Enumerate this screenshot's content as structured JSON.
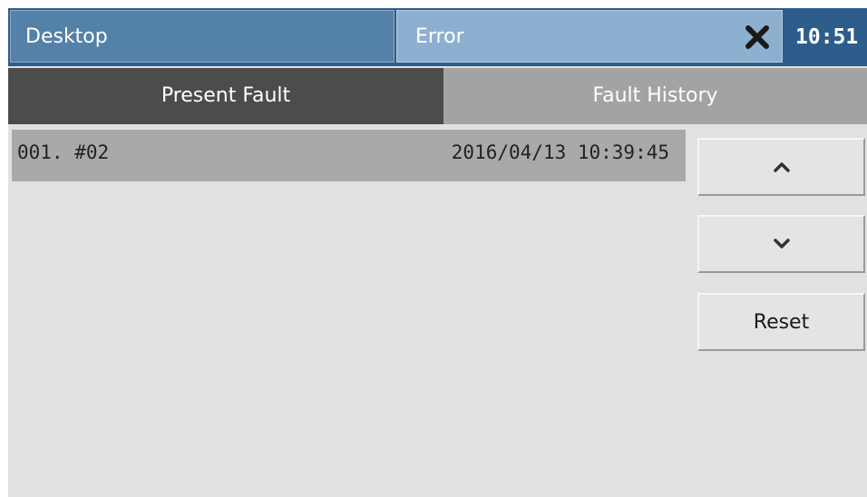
{
  "titlebar": {
    "desktop_label": "Desktop",
    "error_label": "Error",
    "close_icon": "close-x-icon",
    "clock": "10:51"
  },
  "tabs": [
    {
      "label": "Present Fault",
      "active": true
    },
    {
      "label": "Fault History",
      "active": false
    }
  ],
  "faults": [
    {
      "code": "001. #02",
      "timestamp": "2016/04/13 10:39:45"
    }
  ],
  "buttons": {
    "up_icon": "chevron-up-icon",
    "down_icon": "chevron-down-icon",
    "reset_label": "Reset"
  },
  "colors": {
    "titlebar": "#2d5d8a",
    "desktop_tab": "#5481a8",
    "error_tab": "#8eb0d0",
    "active_tab": "#4c4c4c",
    "inactive_tab": "#a4a2a4",
    "selected_row": "#a9a9a9",
    "background": "#e1e1e1"
  }
}
